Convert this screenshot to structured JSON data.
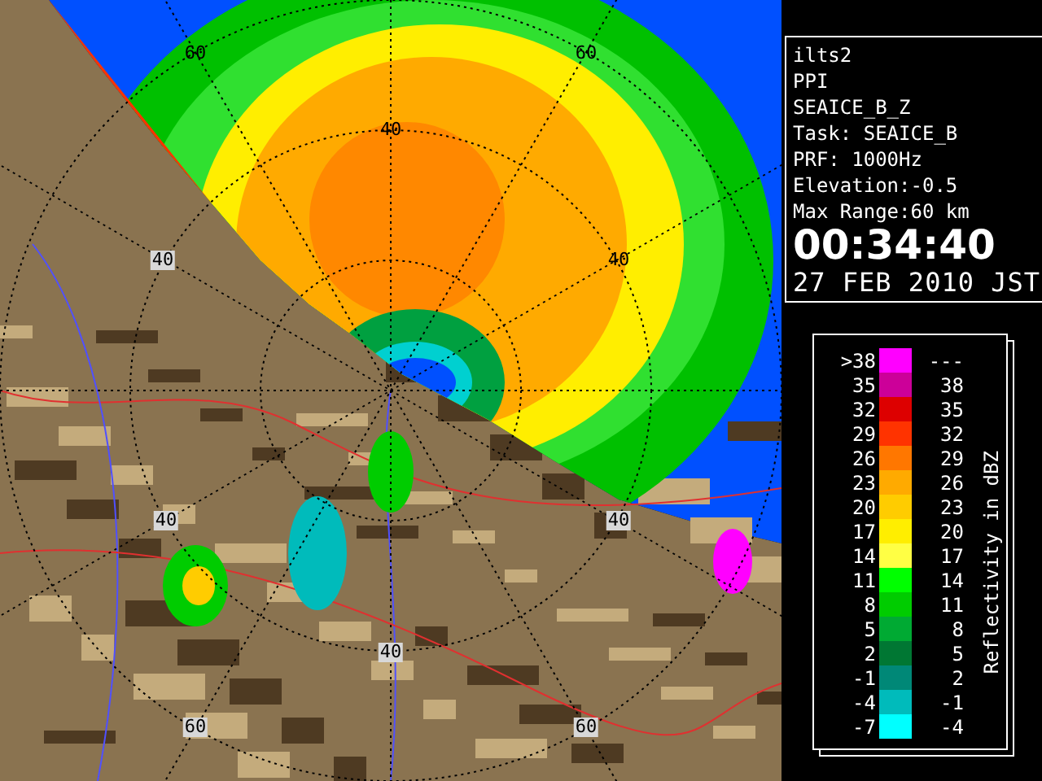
{
  "range_labels": [
    {
      "text": "60",
      "boxed": false
    },
    {
      "text": "60",
      "boxed": false
    },
    {
      "text": "40",
      "boxed": false
    },
    {
      "text": "40",
      "boxed": true
    },
    {
      "text": "40",
      "boxed": false
    },
    {
      "text": "40",
      "boxed": true
    },
    {
      "text": "40",
      "boxed": true
    },
    {
      "text": "40",
      "boxed": true
    },
    {
      "text": "60",
      "boxed": true
    },
    {
      "text": "60",
      "boxed": true
    }
  ],
  "info": {
    "lines": [
      "ilts2",
      "PPI",
      "SEAICE_B_Z",
      "Task: SEAICE_B",
      "PRF: 1000Hz",
      "Elevation:-0.5",
      "Max Range:60 km"
    ],
    "time": "00:34:40",
    "date": "27 FEB 2010 JST"
  },
  "legend": {
    "title": "Reflectivity in dBZ",
    "bins": [
      {
        "low": ">38",
        "high": "---",
        "color": "#ff00ff"
      },
      {
        "low": "35",
        "high": "38",
        "color": "#cc0099"
      },
      {
        "low": "32",
        "high": "35",
        "color": "#dd0000"
      },
      {
        "low": "29",
        "high": "32",
        "color": "#ff3300"
      },
      {
        "low": "26",
        "high": "29",
        "color": "#ff7700"
      },
      {
        "low": "23",
        "high": "26",
        "color": "#ffaa00"
      },
      {
        "low": "20",
        "high": "23",
        "color": "#ffcc00"
      },
      {
        "low": "17",
        "high": "20",
        "color": "#ffee00"
      },
      {
        "low": "14",
        "high": "17",
        "color": "#ffff44"
      },
      {
        "low": "11",
        "high": "14",
        "color": "#00ff00"
      },
      {
        "low": "8",
        "high": "11",
        "color": "#00cc00"
      },
      {
        "low": "5",
        "high": "8",
        "color": "#00aa33"
      },
      {
        "low": "2",
        "high": "5",
        "color": "#007733"
      },
      {
        "low": "-1",
        "high": "2",
        "color": "#008877"
      },
      {
        "low": "-4",
        "high": "-1",
        "color": "#00bbbb"
      },
      {
        "low": "-7",
        "high": "-4",
        "color": "#00ffff"
      }
    ]
  }
}
